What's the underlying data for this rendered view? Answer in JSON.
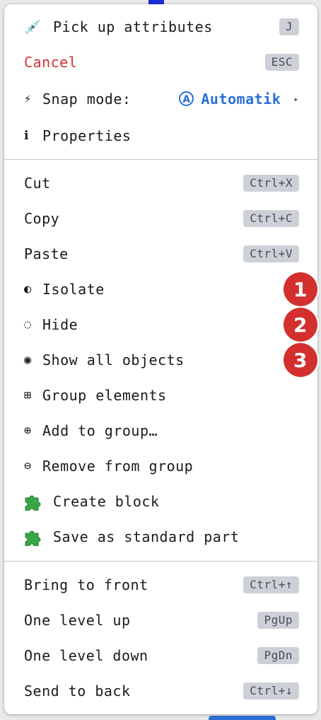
{
  "colors": {
    "danger": "#d32f2f",
    "accent": "#2a6fd6",
    "badge": "#d32f2f",
    "kbd_bg": "#cdd0d6"
  },
  "sections": [
    {
      "items": [
        {
          "name": "pick-up-attributes",
          "icon": "dropper-icon",
          "glyph": "💉",
          "label": "Pick up attributes",
          "shortcut": "J"
        },
        {
          "name": "cancel",
          "label": "Cancel",
          "shortcut": "ESC"
        },
        {
          "name": "snap-mode",
          "icon": "lightning-icon",
          "glyph": "⚡",
          "label": "Snap mode:",
          "value_glyph": "A",
          "value": "Automatik",
          "arrow": "▸"
        },
        {
          "name": "properties",
          "icon": "info-icon",
          "glyph": "ℹ",
          "label": "Properties"
        }
      ]
    },
    {
      "items": [
        {
          "name": "cut",
          "label": "Cut",
          "shortcut": "Ctrl+X"
        },
        {
          "name": "copy",
          "label": "Copy",
          "shortcut": "Ctrl+C"
        },
        {
          "name": "paste",
          "label": "Paste",
          "shortcut": "Ctrl+V"
        },
        {
          "name": "isolate",
          "icon": "half-circle-icon",
          "glyph": "◐",
          "label": "Isolate",
          "badge": "1"
        },
        {
          "name": "hide",
          "icon": "dotted-circle-icon",
          "glyph": "◌",
          "label": "Hide",
          "badge": "2"
        },
        {
          "name": "show-all-objects",
          "icon": "filled-circle-icon",
          "glyph": "◉",
          "label": "Show all objects",
          "badge": "3"
        },
        {
          "name": "group-elements",
          "icon": "group-squares-icon",
          "glyph": "⊞",
          "label": "Group elements"
        },
        {
          "name": "add-to-group",
          "icon": "circled-plus-icon",
          "glyph": "⊕",
          "label": "Add to group…"
        },
        {
          "name": "remove-from-group",
          "icon": "circled-minus-icon",
          "glyph": "⊖",
          "label": "Remove from group"
        },
        {
          "name": "create-block",
          "icon": "puzzle-icon",
          "label": "Create block"
        },
        {
          "name": "save-as-standard-part",
          "icon": "puzzle-icon",
          "label": "Save as standard part"
        }
      ]
    },
    {
      "items": [
        {
          "name": "bring-to-front",
          "label": "Bring to front",
          "shortcut": "Ctrl+↑"
        },
        {
          "name": "one-level-up",
          "label": "One level up",
          "shortcut": "PgUp"
        },
        {
          "name": "one-level-down",
          "label": "One level down",
          "shortcut": "PgDn"
        },
        {
          "name": "send-to-back",
          "label": "Send to back",
          "shortcut": "Ctrl+↓"
        }
      ]
    }
  ]
}
